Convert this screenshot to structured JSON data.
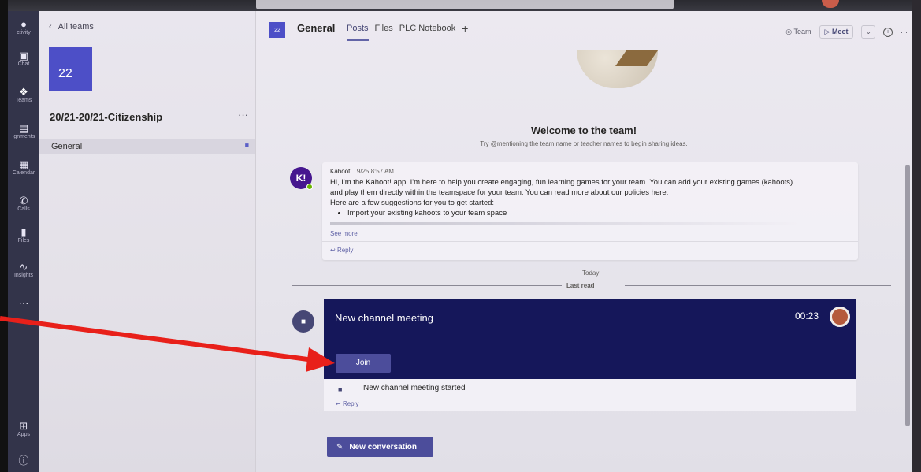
{
  "rail": {
    "items": [
      {
        "id": "activity",
        "label": "ctivity",
        "icon": "bell-icon"
      },
      {
        "id": "chat",
        "label": "Chat",
        "icon": "chat-icon"
      },
      {
        "id": "teams",
        "label": "Teams",
        "icon": "teams-icon"
      },
      {
        "id": "assignments",
        "label": "ignments",
        "icon": "assignments-icon"
      },
      {
        "id": "calendar",
        "label": "Calendar",
        "icon": "calendar-icon"
      },
      {
        "id": "calls",
        "label": "Calls",
        "icon": "phone-icon"
      },
      {
        "id": "files",
        "label": "Files",
        "icon": "file-icon"
      },
      {
        "id": "insights",
        "label": "Insights",
        "icon": "pulse-icon"
      },
      {
        "id": "more",
        "label": "",
        "icon": "more-icon"
      },
      {
        "id": "apps",
        "label": "Apps",
        "icon": "apps-icon"
      }
    ]
  },
  "team_panel": {
    "back_label": "All teams",
    "team_avatar_text": "22",
    "team_name": "20/21-20/21-Citizenship",
    "more_label": "···",
    "channels": [
      {
        "name": "General"
      }
    ]
  },
  "header": {
    "channel_icon_text": "22",
    "channel_title": "General",
    "tabs": [
      "Posts",
      "Files",
      "PLC Notebook"
    ],
    "add_tab": "+",
    "team_label": "Team",
    "meet_label": "Meet",
    "more_label": "···"
  },
  "welcome": {
    "title": "Welcome to the team!",
    "subtitle": "Try @mentioning the team name or teacher names to begin sharing ideas."
  },
  "kahoot_post": {
    "avatar_text": "K!",
    "author": "Kahoot!",
    "time": "9/25 8:57 AM",
    "body_line1": "Hi, I'm the Kahoot! app. I'm here to help you create engaging, fun learning games for your team. You can add your existing games (kahoots)",
    "body_line2": "and play them directly within the teamspace for your team. You can read more about our policies here.",
    "body_line3": "Here are a few suggestions for you to get started:",
    "bullet1": "Import your existing kahoots to your team space",
    "see_more": "See more",
    "reply": "Reply"
  },
  "separator": {
    "today": "Today",
    "last_read": "Last read"
  },
  "meeting": {
    "title": "New channel meeting",
    "duration": "00:23",
    "join_label": "Join",
    "started_text": "New channel meeting started",
    "reply": "Reply"
  },
  "new_conversation_label": "New conversation",
  "colors": {
    "accent": "#6264a7",
    "meeting_bg": "#15175a",
    "rail_bg": "#33344a",
    "annotation_arrow": "#e8201a"
  }
}
